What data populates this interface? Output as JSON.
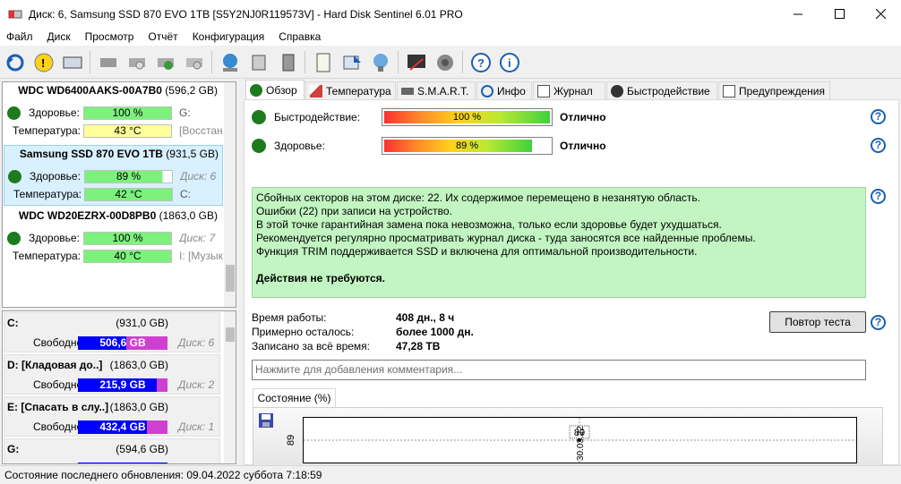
{
  "window": {
    "title": "Диск: 6, Samsung SSD 870 EVO 1TB [S5Y2NJ0R119573V]  -  Hard Disk Sentinel 6.01 PRO"
  },
  "menu": [
    "Файл",
    "Диск",
    "Просмотр",
    "Отчёт",
    "Конфигурация",
    "Справка"
  ],
  "disks": [
    {
      "name": "WDC WD6400AAKS-00A7B0",
      "size": "(596,2 GB)",
      "health_label": "Здоровье:",
      "health": "100 %",
      "health_fill": 1.0,
      "temp_label": "Температура:",
      "temp": "43 °C",
      "temp_color": "#ffff99",
      "aux1": "G:",
      "aux2": "[Восстан",
      "selected": false
    },
    {
      "name": "Samsung SSD 870 EVO 1TB",
      "size": "(931,5 GB)",
      "health_label": "Здоровье:",
      "health": "89 %",
      "health_fill": 0.89,
      "temp_label": "Температура:",
      "temp": "42 °C",
      "temp_color": "#7cf27c",
      "aux1": "Диск: 6",
      "aux2": "C:",
      "selected": true
    },
    {
      "name": "WDC WD20EZRX-00D8PB0",
      "size": "(1863,0 GB)",
      "health_label": "Здоровье:",
      "health": "100 %",
      "health_fill": 1.0,
      "temp_label": "Температура:",
      "temp": "40 °C",
      "temp_color": "#7cf27c",
      "aux1": "Диск: 7",
      "aux2": "I: [Музык",
      "selected": false
    }
  ],
  "volumes": [
    {
      "name": "C:",
      "size": "(931,0 GB)",
      "free_label": "Свободно",
      "free": "506,6 GB",
      "used_fraction": 0.46,
      "disk": "Диск: 6"
    },
    {
      "name": "D: [Кладовая до..]",
      "size": "(1863,0 GB)",
      "free_label": "Свободно",
      "free": "215,9 GB",
      "used_fraction": 0.12,
      "disk": "Диск: 2"
    },
    {
      "name": "E: [Спасать в слу..]",
      "size": "(1863,0 GB)",
      "free_label": "Свободно",
      "free": "432,4 GB",
      "used_fraction": 0.23,
      "disk": "Диск: 1"
    },
    {
      "name": "G:",
      "size": "(594,6 GB)",
      "free_label": "",
      "free": "",
      "used_fraction": 0,
      "disk": ""
    }
  ],
  "tabs": [
    "Обзор",
    "Температура",
    "S.M.A.R.T.",
    "Инфо",
    "Журнал",
    "Быстродействие",
    "Предупреждения"
  ],
  "overview": {
    "perf_label": "Быстродействие:",
    "perf_value": "100 %",
    "perf_fill": 1.0,
    "perf_status": "Отлично",
    "health_label": "Здоровье:",
    "health_value": "89 %",
    "health_fill": 0.89,
    "health_status": "Отлично",
    "info_lines": [
      "Сбойных секторов на этом диске: 22. Их содержимое перемещено в незанятую область.",
      "Ошибки (22) при записи на устройство.",
      "В этой точке гарантийная замена пока невозможна, только если здоровье будет ухудшаться.",
      "Рекомендуется регулярно просматривать журнал диска - туда заносятся все найденные проблемы.",
      "Функция TRIM поддерживается SSD и включена для оптимальной производительности."
    ],
    "action": "Действия не требуются.",
    "uptime_label": "Время работы:",
    "uptime": "408 дн., 8 ч",
    "remaining_label": "Примерно осталось:",
    "remaining": "более 1000 дн.",
    "written_label": "Записано за всё время:",
    "written": "47,28 TB",
    "retest_button": "Повтор теста",
    "comment_placeholder": "Нажмите для добавления комментария..."
  },
  "chart_tab": "Состояние (%)",
  "chart_data": {
    "type": "line",
    "x": [
      "30.03.22"
    ],
    "series": [
      {
        "values": [
          89
        ]
      }
    ],
    "ytick": "89",
    "point_label": "89",
    "xtick": "30.03.22"
  },
  "status": "Состояние последнего обновления: 09.04.2022 суббота 7:18:59"
}
